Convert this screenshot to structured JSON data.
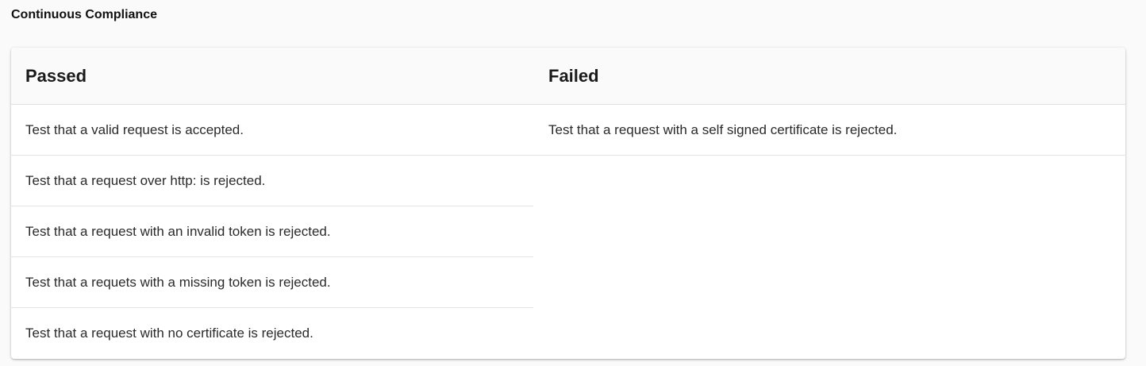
{
  "page": {
    "title": "Continuous Compliance"
  },
  "table": {
    "passed_header": "Passed",
    "failed_header": "Failed",
    "passed": [
      "Test that a valid request is accepted.",
      "Test that a request over http: is rejected.",
      "Test that a request with an invalid token is rejected.",
      "Test that a requets with a missing token is rejected.",
      "Test that a request with no certificate is rejected."
    ],
    "failed": [
      "Test that a request with a self signed certificate is rejected."
    ]
  },
  "colors": {
    "background": "#fafafa",
    "card": "#ffffff",
    "header_background": "#fafafa",
    "divider": "#e4e4e4"
  }
}
